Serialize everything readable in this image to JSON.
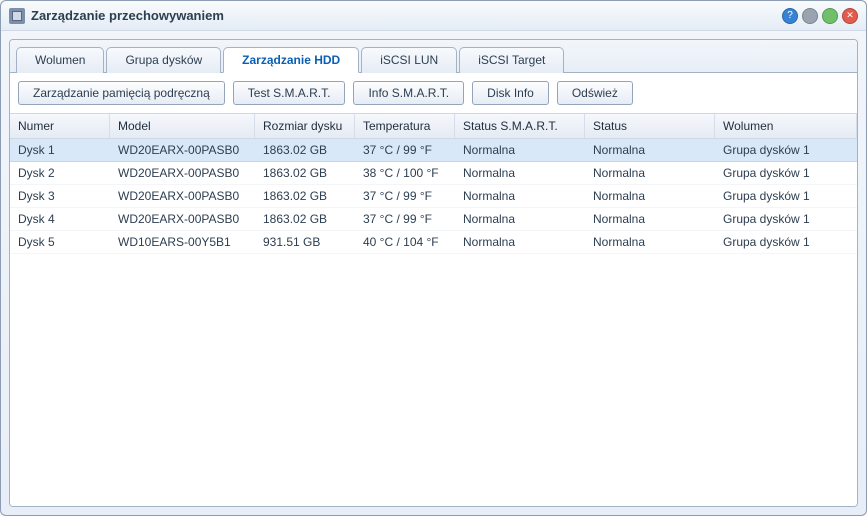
{
  "window": {
    "title": "Zarządzanie przechowywaniem"
  },
  "tabs": [
    {
      "label": "Wolumen",
      "active": false
    },
    {
      "label": "Grupa dysków",
      "active": false
    },
    {
      "label": "Zarządzanie HDD",
      "active": true
    },
    {
      "label": "iSCSI LUN",
      "active": false
    },
    {
      "label": "iSCSI Target",
      "active": false
    }
  ],
  "toolbar": {
    "cache": "Zarządzanie pamięcią podręczną",
    "smart_test": "Test S.M.A.R.T.",
    "smart_info": "Info S.M.A.R.T.",
    "disk_info": "Disk Info",
    "refresh": "Odśwież"
  },
  "columns": {
    "number": "Numer",
    "model": "Model",
    "size": "Rozmiar dysku",
    "temp": "Temperatura",
    "smart_status": "Status S.M.A.R.T.",
    "status": "Status",
    "volume": "Wolumen"
  },
  "rows": [
    {
      "number": "Dysk 1",
      "model": "WD20EARX-00PASB0",
      "size": "1863.02 GB",
      "temp": "37 °C / 99 °F",
      "smart_status": "Normalna",
      "status": "Normalna",
      "volume": "Grupa dysków 1",
      "selected": true
    },
    {
      "number": "Dysk 2",
      "model": "WD20EARX-00PASB0",
      "size": "1863.02 GB",
      "temp": "38 °C / 100 °F",
      "smart_status": "Normalna",
      "status": "Normalna",
      "volume": "Grupa dysków 1",
      "selected": false
    },
    {
      "number": "Dysk 3",
      "model": "WD20EARX-00PASB0",
      "size": "1863.02 GB",
      "temp": "37 °C / 99 °F",
      "smart_status": "Normalna",
      "status": "Normalna",
      "volume": "Grupa dysków 1",
      "selected": false
    },
    {
      "number": "Dysk 4",
      "model": "WD20EARX-00PASB0",
      "size": "1863.02 GB",
      "temp": "37 °C / 99 °F",
      "smart_status": "Normalna",
      "status": "Normalna",
      "volume": "Grupa dysków 1",
      "selected": false
    },
    {
      "number": "Dysk 5",
      "model": "WD10EARS-00Y5B1",
      "size": "931.51 GB",
      "temp": "40 °C / 104 °F",
      "smart_status": "Normalna",
      "status": "Normalna",
      "volume": "Grupa dysków 1",
      "selected": false
    }
  ]
}
